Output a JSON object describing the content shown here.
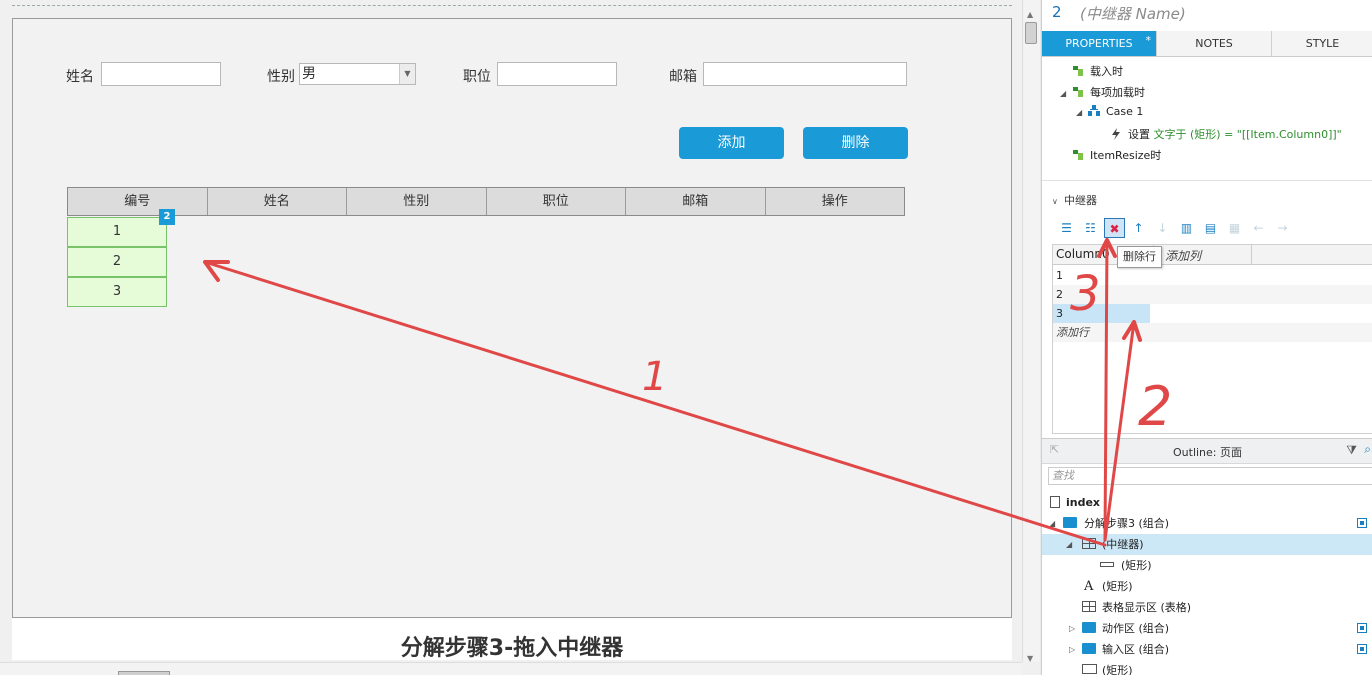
{
  "canvas": {
    "form": {
      "name_label": "姓名",
      "gender_label": "性别",
      "gender_value": "男",
      "position_label": "职位",
      "email_label": "邮箱"
    },
    "buttons": {
      "add": "添加",
      "delete": "删除"
    },
    "grid_headers": [
      "编号",
      "姓名",
      "性别",
      "职位",
      "邮箱",
      "操作"
    ],
    "repeater_badge": "2",
    "repeater_rows": [
      "1",
      "2",
      "3"
    ],
    "caption": "分解步骤3-拖入中继器",
    "annotations": [
      "1",
      "2",
      "3"
    ],
    "annotation_color": "#e04848"
  },
  "inspector": {
    "name_index": "2",
    "name_placeholder": "(中继器 Name)",
    "tabs": [
      "PROPERTIES",
      "NOTES",
      "STYLE"
    ],
    "tab_marker": "*",
    "events": {
      "onload": "载入时",
      "onitemload": "每项加载时",
      "case": "Case 1",
      "action_verb": "设置",
      "action_detail": "文字于 (矩形) = \"[[Item.Column0]]\"",
      "item_resize": "ItemResize时"
    },
    "repeater_section": "中继器",
    "tooltip": "删除行",
    "dataset": {
      "column_header": "Column0",
      "add_column": "添加列",
      "rows": [
        "1",
        "2",
        "3"
      ],
      "add_row": "添加行"
    },
    "outline": {
      "title": "Outline: 页面",
      "search_placeholder": "查找",
      "items": [
        {
          "label": "index"
        },
        {
          "label": "分解步骤3 (组合)"
        },
        {
          "label": "(中继器)"
        },
        {
          "label": "(矩形)"
        },
        {
          "label": "(矩形)"
        },
        {
          "label": "表格显示区 (表格)"
        },
        {
          "label": "动作区 (组合)"
        },
        {
          "label": "输入区 (组合)"
        },
        {
          "label": "(矩形)"
        }
      ]
    }
  },
  "colors": {
    "accent": "#1a9ad6",
    "repeater_fill": "#e6fcd9",
    "repeater_border": "#79c46a",
    "selection": "#cce8f7"
  }
}
